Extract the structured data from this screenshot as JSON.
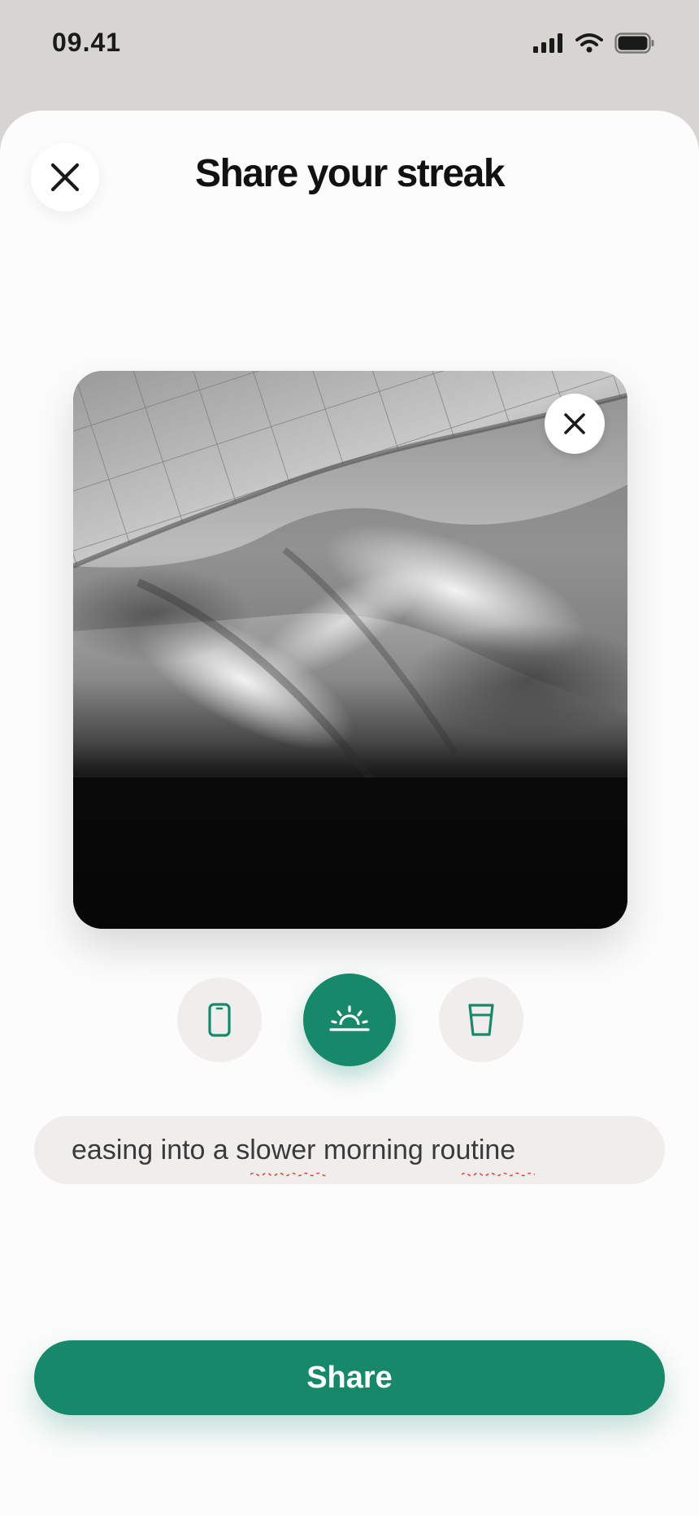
{
  "status_bar": {
    "time": "09.41",
    "icons": [
      "signal-icon",
      "wifi-icon",
      "battery-icon"
    ]
  },
  "header": {
    "title": "Share your streak",
    "close_icon": "close-icon"
  },
  "photo": {
    "remove_icon": "close-icon",
    "subject": "black-and-white photo of rumpled bed sheets"
  },
  "habits": [
    {
      "icon": "phone-icon",
      "selected": false
    },
    {
      "icon": "sunrise-icon",
      "selected": true
    },
    {
      "icon": "glass-icon",
      "selected": false
    }
  ],
  "caption": {
    "value": "easing into a slower morning routine"
  },
  "share_button": {
    "label": "Share"
  },
  "colors": {
    "accent": "#17896a",
    "sheet": "#fcfcfc",
    "backdrop": "#d6d5d2",
    "field": "#efeeec",
    "spellcheck": "#e0443c"
  }
}
